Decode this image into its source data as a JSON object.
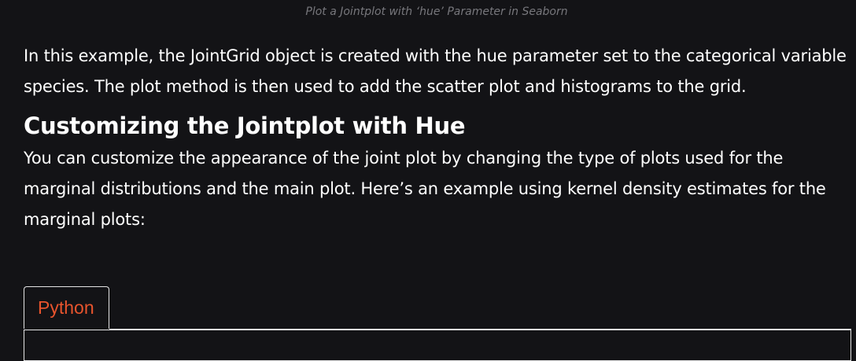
{
  "caption": "Plot a Jointplot with ‘hue’ Parameter in Seaborn",
  "paragraph1": "In this example, the JointGrid object is created with the hue parameter set to the categorical variable species. The plot method is then used to add the scatter plot and histograms to the grid.",
  "heading": "Customizing the Jointplot with Hue",
  "paragraph2": "You can customize the appearance of the joint plot by changing the type of plots used for the marginal distributions and the main plot. Here’s an example using kernel density estimates for the marginal plots:",
  "code_tabs": [
    {
      "label": "Python"
    }
  ],
  "colors": {
    "background": "#131316",
    "text": "#ffffff",
    "caption": "#77777c",
    "tab_accent": "#e8542d",
    "border": "#e5e5e5"
  }
}
